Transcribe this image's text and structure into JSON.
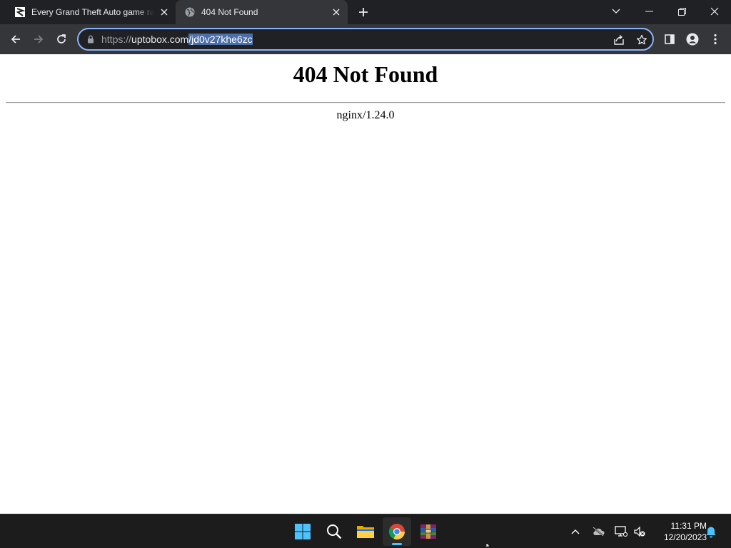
{
  "browser": {
    "tabs": [
      {
        "title": "Every Grand Theft Auto game ranked",
        "favicon": "site-logo-icon",
        "active": false
      },
      {
        "title": "404 Not Found",
        "favicon": "globe-icon",
        "active": true
      }
    ],
    "address_bar": {
      "scheme": "https://",
      "host": "uptobox.com",
      "path": "/jd0v27khe6zc"
    }
  },
  "page": {
    "heading": "404 Not Found",
    "server": "nginx/1.24.0"
  },
  "taskbar": {
    "apps": [
      "windows-start-icon",
      "search-icon",
      "file-explorer-icon",
      "chrome-icon",
      "winrar-icon"
    ],
    "tray": [
      "show-hidden-icons-chevron",
      "onedrive-offline-icon",
      "network-icon",
      "volume-muted-icon",
      "notification-bell-icon"
    ],
    "time": "11:31 PM",
    "date": "12/20/2023"
  },
  "colors": {
    "tabstrip": "#202124",
    "toolbar": "#35363a",
    "omnibox_focus": "#8ab4f8",
    "selection": "#4b6fa8",
    "taskbar": "#1c1c1c",
    "accent": "#4cc2ff"
  }
}
